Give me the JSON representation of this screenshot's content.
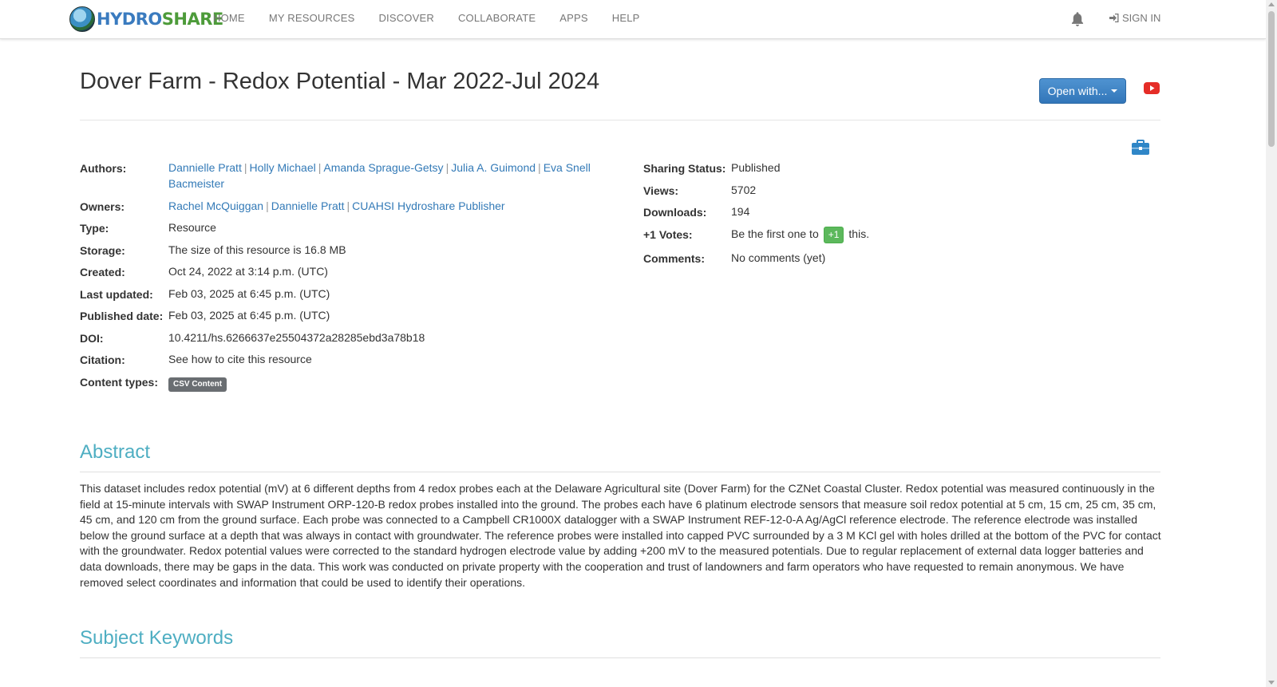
{
  "nav": {
    "logo": {
      "hydro": "HYDRO",
      "share": "SHARE"
    },
    "links": [
      "HOME",
      "MY RESOURCES",
      "DISCOVER",
      "COLLABORATE",
      "APPS",
      "HELP"
    ],
    "signin": "SIGN IN"
  },
  "resource": {
    "title": "Dover Farm - Redox Potential - Mar 2022-Jul 2024",
    "open_with": "Open with..."
  },
  "meta_left": {
    "authors_label": "Authors:",
    "authors": [
      "Dannielle Pratt",
      "Holly Michael",
      "Amanda Sprague-Getsy",
      "Julia A. Guimond",
      "Eva Snell",
      "Bacmeister"
    ],
    "owners_label": "Owners:",
    "owners": [
      "Rachel McQuiggan",
      "Dannielle Pratt",
      "CUAHSI Hydroshare Publisher"
    ],
    "type_label": "Type:",
    "type": "Resource",
    "storage_label": "Storage:",
    "storage": "The size of this resource is 16.8 MB",
    "created_label": "Created:",
    "created": "Oct 24, 2022 at 3:14 p.m. (UTC)",
    "updated_label": "Last updated:",
    "updated": "Feb 03, 2025 at 6:45 p.m. (UTC)",
    "published_label": "Published date:",
    "published": "Feb 03, 2025 at 6:45 p.m. (UTC)",
    "doi_label": "DOI:",
    "doi": "10.4211/hs.6266637e25504372a28285ebd3a78b18",
    "citation_label": "Citation:",
    "citation_link": "See how to cite this resource",
    "content_types_label": "Content types:",
    "content_type_badge": "CSV Content"
  },
  "meta_right": {
    "sharing_label": "Sharing Status:",
    "sharing": "Published",
    "views_label": "Views:",
    "views": "5702",
    "downloads_label": "Downloads:",
    "downloads": "194",
    "votes_label": "+1 Votes:",
    "votes_prefix": "Be the first one to",
    "votes_button": "+1",
    "votes_suffix": "this.",
    "comments_label": "Comments:",
    "comments_link": "No comments (yet)"
  },
  "abstract": {
    "heading": "Abstract",
    "text": "This dataset includes redox potential (mV) at 6 different depths from 4 redox probes each at the Delaware Agricultural site (Dover Farm) for the CZNet Coastal Cluster. Redox potential was measured continuously in the field at 15-minute intervals with SWAP Instrument ORP-120-B redox probes installed into the ground. The probes each have 6 platinum electrode sensors that measure soil redox potential at 5 cm, 15 cm, 25 cm, 35 cm, 45 cm, and 120 cm from the ground surface. Each probe was connected to a Campbell CR1000X datalogger with a SWAP Instrument REF-12-0-A Ag/AgCl reference electrode. The reference electrode was installed below the ground surface at a depth that was always in contact with groundwater. The reference probes were installed into capped PVC surrounded by a 3 M KCl gel with holes drilled at the bottom of the PVC for contact with the groundwater. Redox potential values were corrected to the standard hydrogen electrode value by adding +200 mV to the measured potentials. Due to regular replacement of external data logger batteries and data downloads, there may be gaps in the data. This work was conducted on private property with the cooperation and trust of landowners and farm operators who have requested to remain anonymous. We have removed select coordinates and information that could be used to identify their operations."
  },
  "keywords": {
    "heading": "Subject Keywords"
  },
  "icons": {
    "bell": "bell-icon",
    "signin": "sign-in-icon",
    "youtube": "youtube-icon",
    "briefcase": "briefcase-icon"
  },
  "colors": {
    "accent": "#337ab7",
    "section_heading": "#4eaec2",
    "vote_green": "#5cb85c",
    "youtube_red": "#e52d27"
  }
}
